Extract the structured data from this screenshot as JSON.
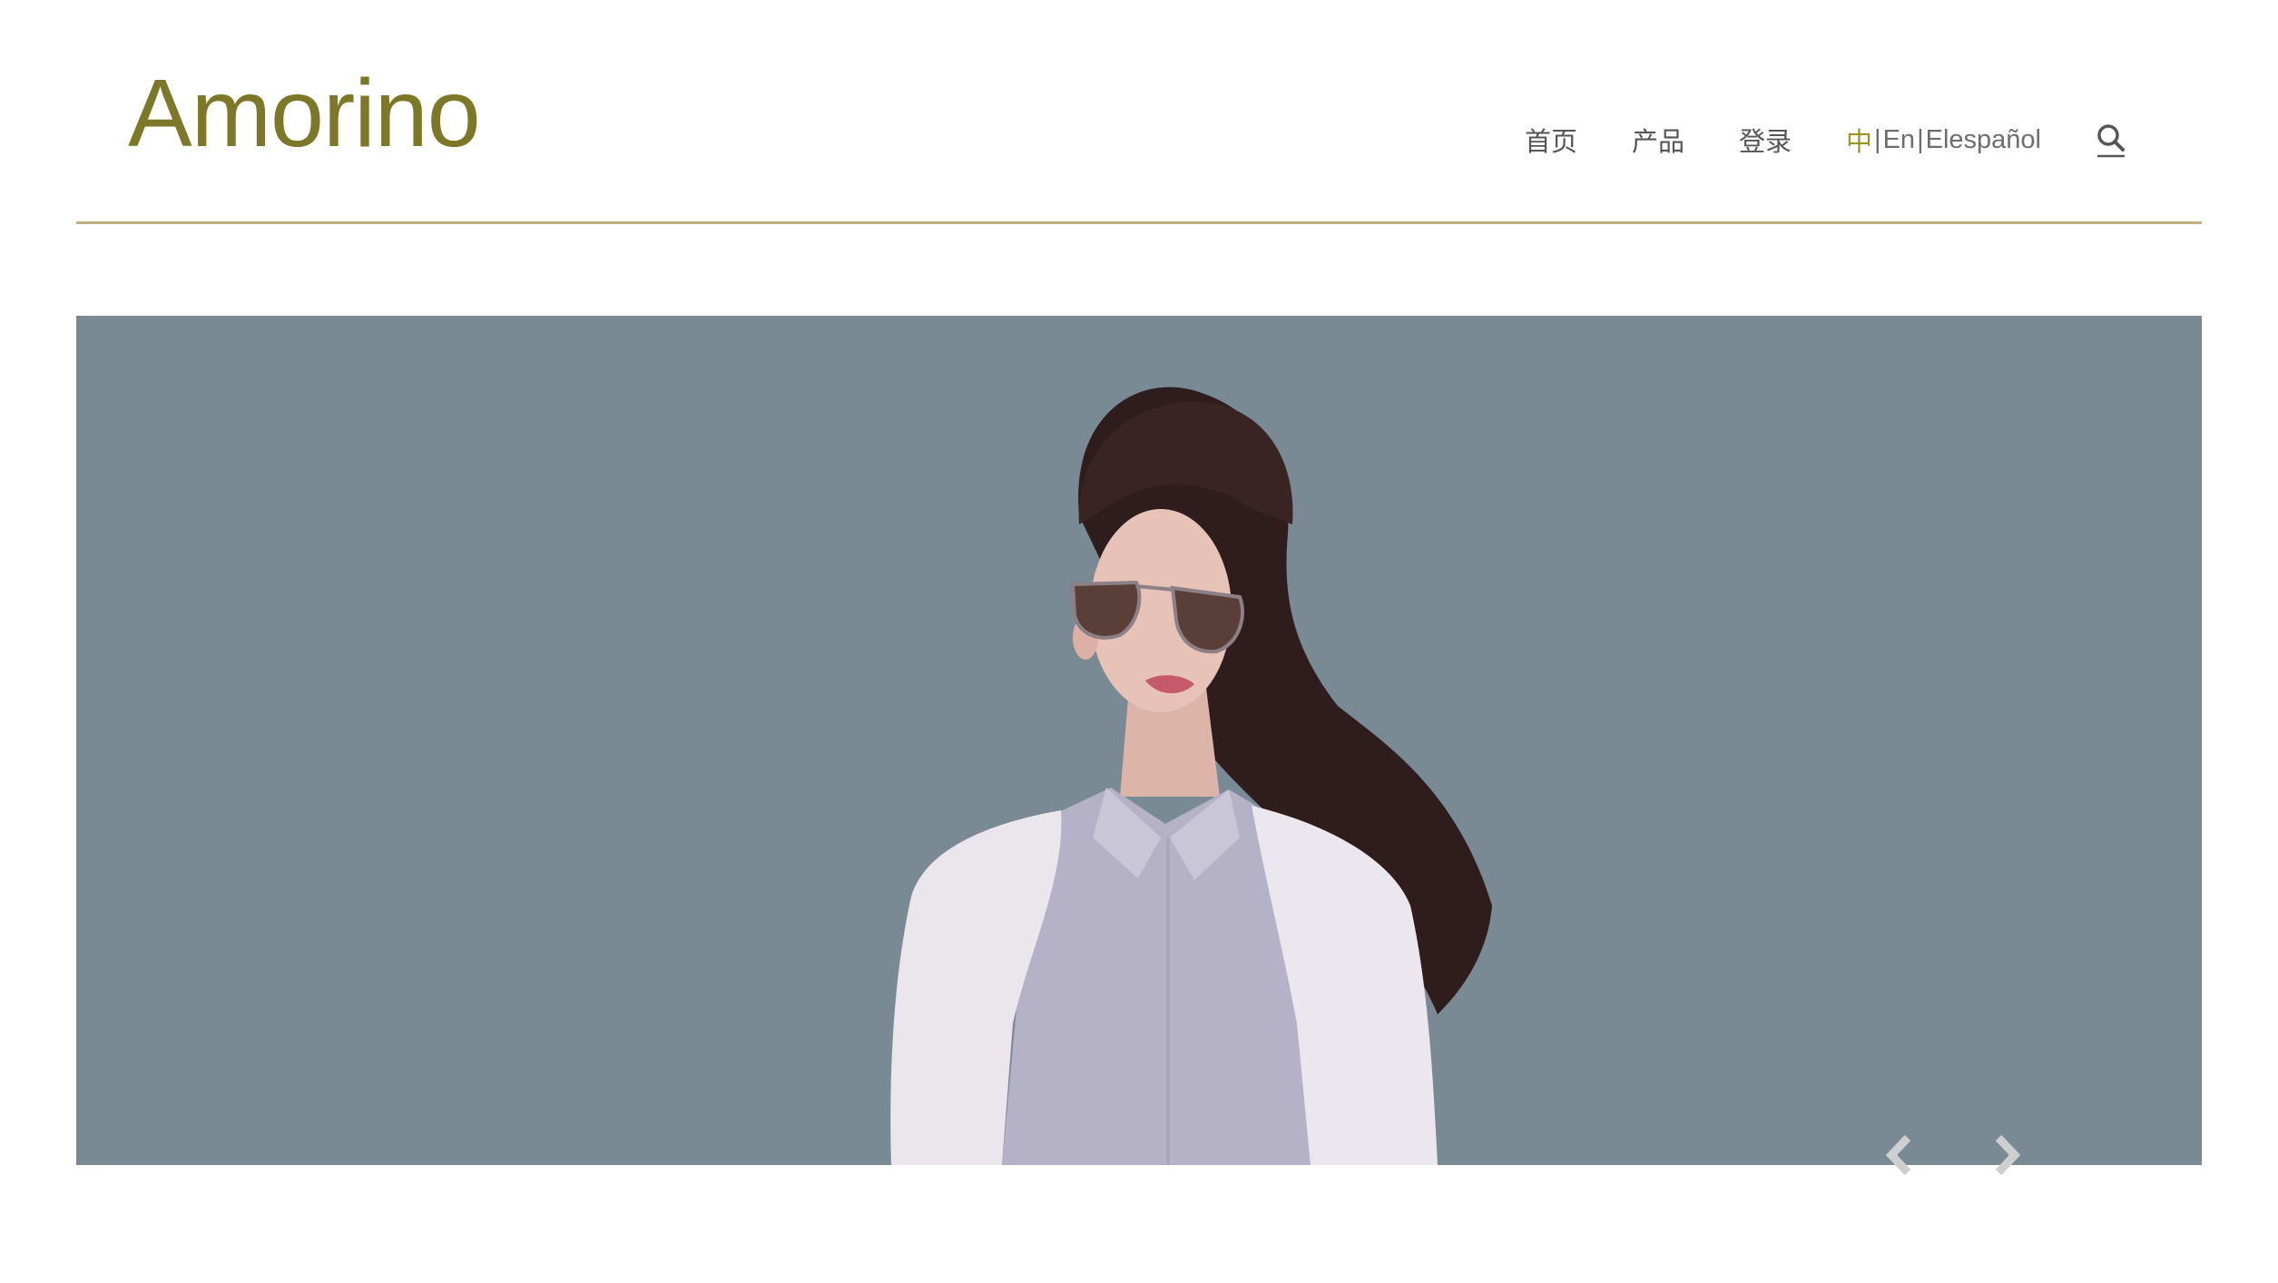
{
  "header": {
    "logo_text": "Amorino",
    "brand_color": "#7c7828",
    "nav": {
      "home_label": "首页",
      "products_label": "产品",
      "login_label": "登录"
    },
    "language": {
      "zh_label": "中",
      "separator": "|",
      "en_label": "En",
      "es_label": "Elespañol",
      "active": "中",
      "active_color": "#9a9521"
    },
    "search_icon": "search-icon"
  },
  "hero": {
    "background_color": "#7a8a95",
    "image_subject": "woman-in-sunglasses-and-white-blazer",
    "prev_icon": "chevron-left-icon",
    "next_icon": "chevron-right-icon"
  }
}
